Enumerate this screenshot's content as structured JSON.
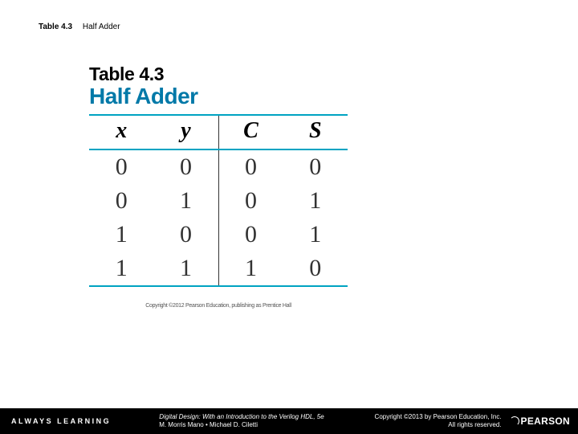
{
  "caption": {
    "number": "Table 4.3",
    "title": "Half Adder"
  },
  "figure": {
    "heading_number": "Table 4.3",
    "heading_title": "Half Adder",
    "copyright_small": "Copyright ©2012 Pearson Education, publishing as Prentice Hall"
  },
  "chart_data": {
    "type": "table",
    "columns": [
      "x",
      "y",
      "C",
      "S"
    ],
    "rows": [
      [
        0,
        0,
        0,
        0
      ],
      [
        0,
        1,
        0,
        1
      ],
      [
        1,
        0,
        0,
        1
      ],
      [
        1,
        1,
        1,
        0
      ]
    ]
  },
  "footer": {
    "always_learning": "ALWAYS LEARNING",
    "book_title": "Digital Design: With an Introduction to the Verilog HDL, 5e",
    "authors": "M. Morris Mano • Michael D. Ciletti",
    "copyright_line1": "Copyright ©2013 by Pearson Education, Inc.",
    "copyright_line2": "All rights reserved.",
    "publisher": "PEARSON"
  }
}
